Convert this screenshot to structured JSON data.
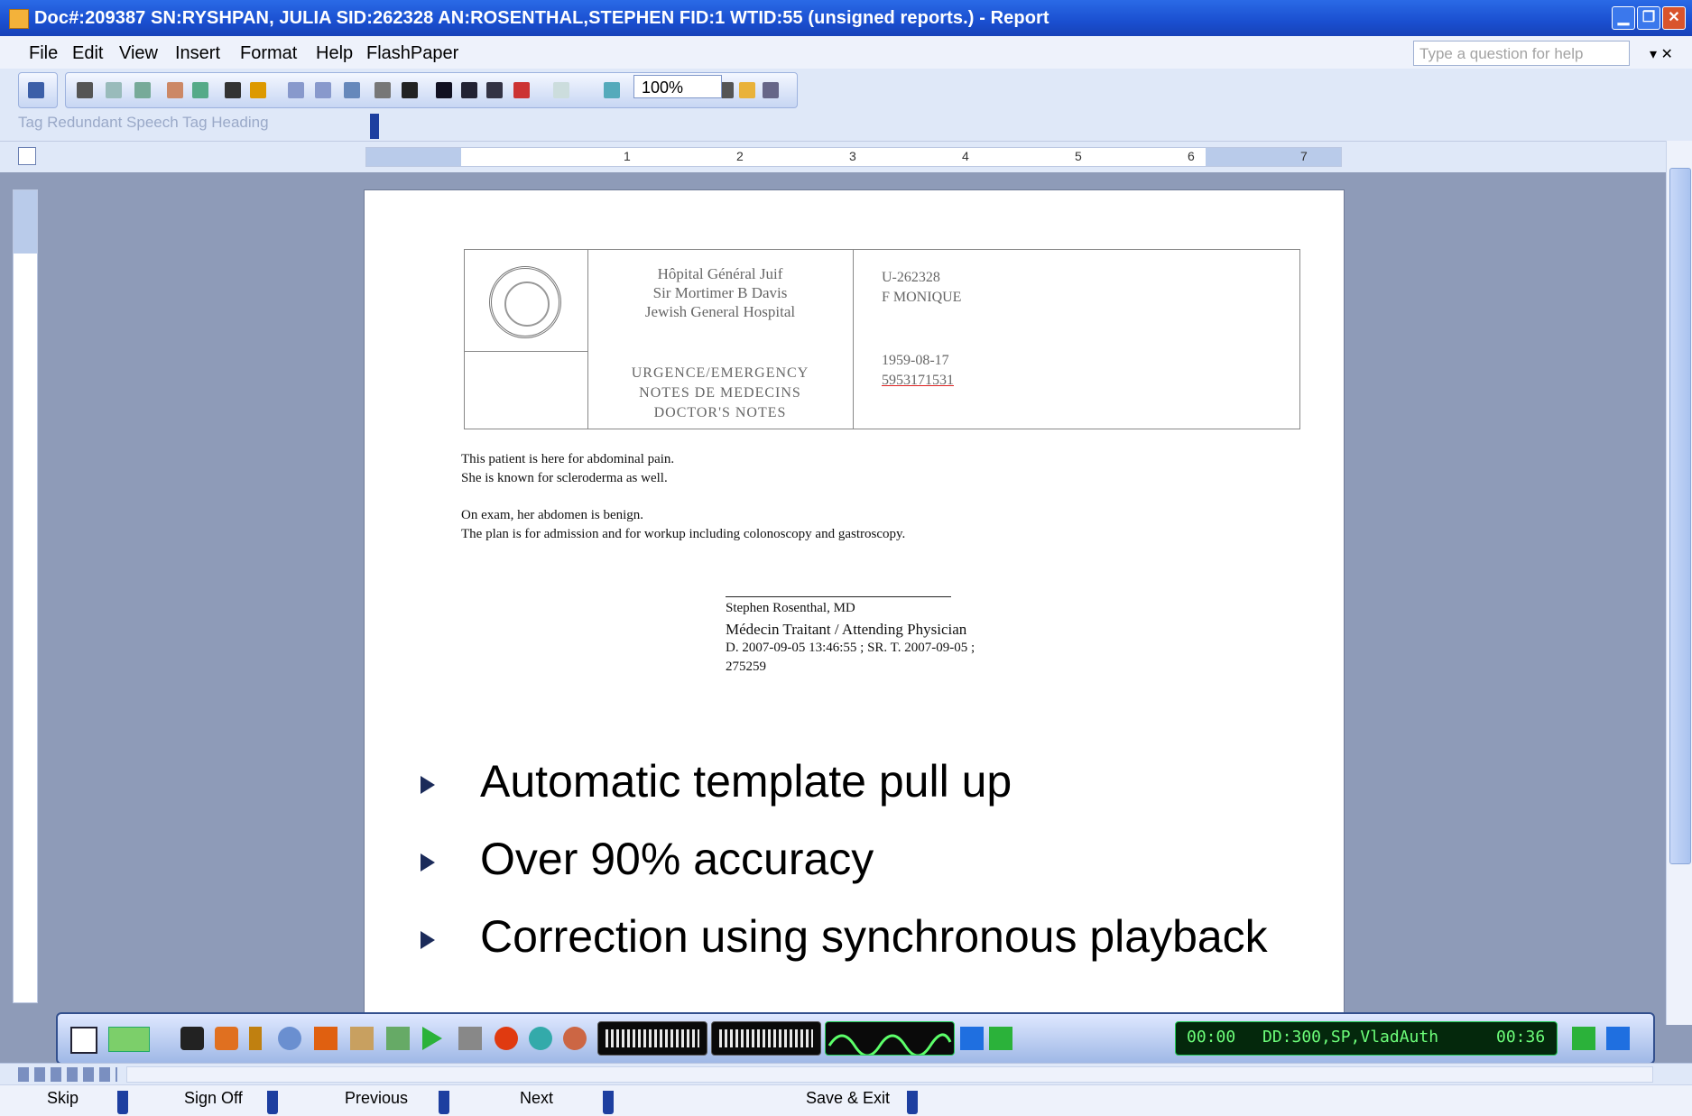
{
  "window": {
    "title": "Doc#:209387 SN:RYSHPAN, JULIA SID:262328 AN:ROSENTHAL,STEPHEN FID:1 WTID:55   (unsigned reports.) - Report"
  },
  "menubar": {
    "items": [
      "File",
      "Edit",
      "View",
      "Insert",
      "Format",
      "Help",
      "FlashPaper"
    ],
    "help_placeholder": "Type a question for help"
  },
  "toolbar": {
    "zoom": "100%",
    "tag_buttons": "Tag Redundant Speech  Tag Heading"
  },
  "ruler": {
    "labels": [
      "1",
      "2",
      "3",
      "4",
      "5",
      "6",
      "7"
    ]
  },
  "document": {
    "hospital": [
      "Hôpital Général Juif",
      "Sir Mortimer B Davis",
      "Jewish General Hospital"
    ],
    "notes_title": [
      "URGENCE/EMERGENCY",
      "NOTES DE MEDECINS",
      "DOCTOR'S NOTES"
    ],
    "patient": {
      "unit": "U-262328",
      "name": "F MONIQUE",
      "dob": "1959-08-17",
      "number": "5953171531"
    },
    "body": [
      "This patient is here for abdominal pain.",
      "She is known for scleroderma as well.",
      "On exam, her abdomen is benign.",
      "The plan is for admission and for workup including colonoscopy and gastroscopy."
    ],
    "signature": [
      "Stephen Rosenthal, MD",
      "Médecin Traitant / Attending Physician",
      "D. 2007-09-05 13:46:55 ; SR. T. 2007-09-05 ;",
      "275259"
    ]
  },
  "bullets": [
    "Automatic template pull up",
    "Over 90% accuracy",
    "Correction using synchronous playback"
  ],
  "media": {
    "time_start": "00:00",
    "lcd_text": "DD:300,SP,VladAuth",
    "time_end": "00:36"
  },
  "buttons": {
    "skip": "Skip",
    "sign_off": "Sign Off",
    "previous": "Previous",
    "next": "Next",
    "save_exit": "Save & Exit"
  },
  "colors": {
    "titlebar": "#1a4fd0",
    "desktop": "#8e9bb8",
    "lcd_text": "#6dff7a",
    "bullet_arrow": "#1b2b5a"
  }
}
